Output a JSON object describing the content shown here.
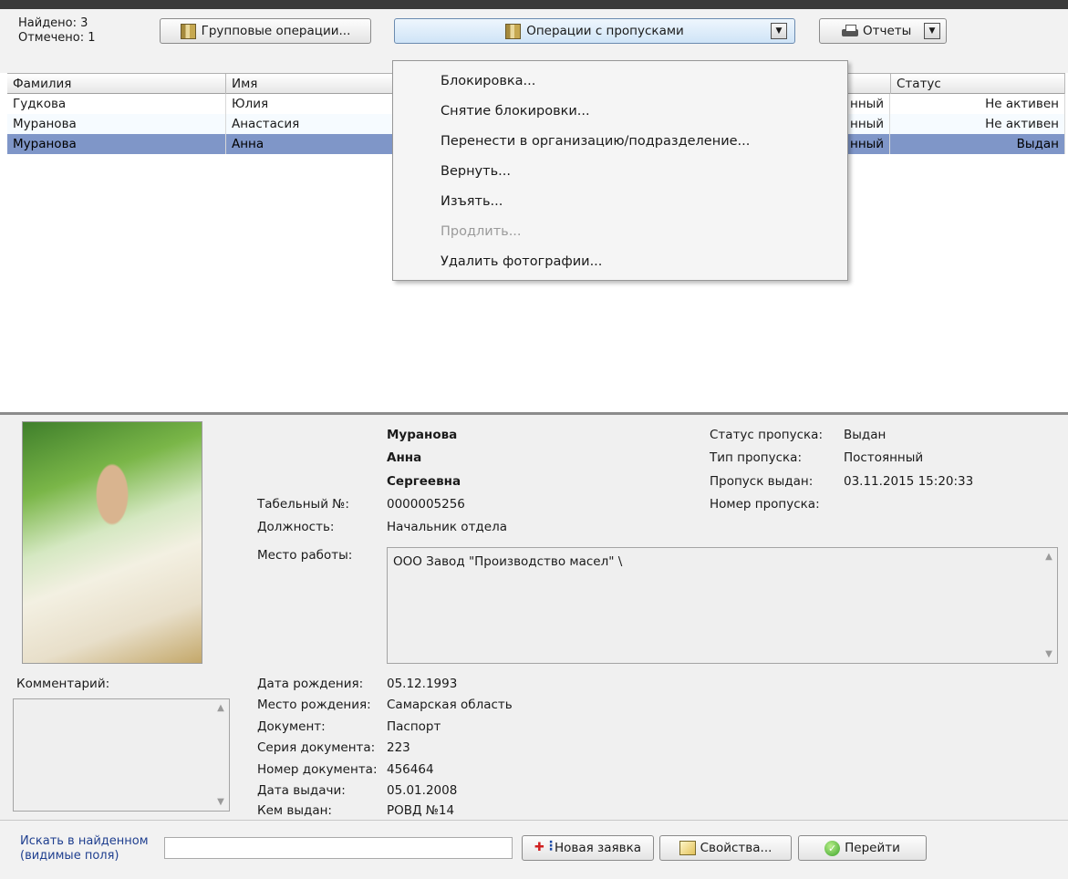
{
  "counts": {
    "found": "Найдено: 3",
    "marked": "Отмечено: 1"
  },
  "toolbar": {
    "group_ops": "Групповые операции...",
    "pass_ops": "Операции с пропусками",
    "reports": "Отчеты"
  },
  "grid": {
    "columns": [
      "Фамилия",
      "Имя",
      "Статус"
    ],
    "rows": [
      {
        "surname": "Гудкова",
        "name": "Юлия",
        "type_tail": "нный",
        "status": "Не активен"
      },
      {
        "surname": "Муранова",
        "name": "Анастасия",
        "type_tail": "нный",
        "status": "Не активен"
      },
      {
        "surname": "Муранова",
        "name": "Анна",
        "type_tail": "нный",
        "status": "Выдан"
      }
    ]
  },
  "menu": {
    "items": [
      {
        "label": "Блокировка...",
        "enabled": true
      },
      {
        "label": "Снятие блокировки...",
        "enabled": true
      },
      {
        "label": "Перенести в организацию/подразделение...",
        "enabled": true
      },
      {
        "label": "Вернуть...",
        "enabled": true
      },
      {
        "label": "Изъять...",
        "enabled": true
      },
      {
        "label": "Продлить...",
        "enabled": false
      },
      {
        "label": "Удалить фотографии...",
        "enabled": true
      }
    ]
  },
  "person": {
    "surname": "Муранова",
    "name": "Анна",
    "patronymic": "Сергеевна",
    "tab_label": "Табельный №:",
    "tab_value": "0000005256",
    "position_label": "Должность:",
    "position_value": "Начальник отдела",
    "workplace_label": "Место работы:",
    "workplace_value": "ООО Завод \"Производство масел\" \\",
    "birth_date_label": "Дата рождения:",
    "birth_date_value": "05.12.1993",
    "birth_place_label": "Место рождения:",
    "birth_place_value": "Самарская область",
    "doc_label": "Документ:",
    "doc_value": "Паспорт",
    "doc_series_label": "Серия документа:",
    "doc_series_value": "223",
    "doc_number_label": "Номер документа:",
    "doc_number_value": "456464",
    "issue_date_label": "Дата выдачи:",
    "issue_date_value": "05.01.2008",
    "issued_by_label": "Кем выдан:",
    "issued_by_value": "РОВД №14",
    "comment_label": "Комментарий:"
  },
  "pass": {
    "status_label": "Статус пропуска:",
    "status_value": "Выдан",
    "type_label": "Тип пропуска:",
    "type_value": "Постоянный",
    "issued_label": "Пропуск выдан:",
    "issued_value": "03.11.2015 15:20:33",
    "number_label": "Номер пропуска:",
    "number_value": ""
  },
  "bottom": {
    "search_label_1": "Искать в найденном",
    "search_label_2": "(видимые поля)",
    "search_value": "",
    "new_request": "Новая заявка",
    "properties": "Свойства...",
    "go": "Перейти"
  }
}
